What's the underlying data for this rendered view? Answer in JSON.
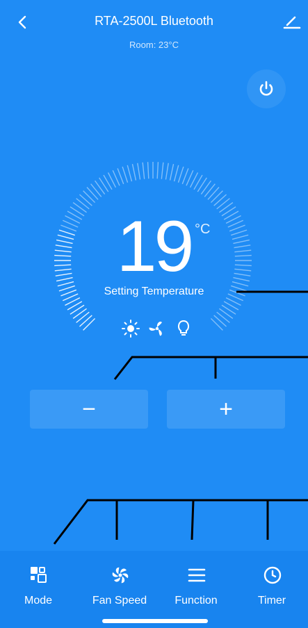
{
  "header": {
    "title": "RTA-2500L Bluetooth",
    "subtitle": "Room: 23°C",
    "icons": [
      "back-chevron-icon",
      "edit-pencil-icon"
    ]
  },
  "power": {
    "icon": "power-icon"
  },
  "thermostat": {
    "temperature": "19",
    "unit": "°C",
    "label": "Setting Temperature",
    "status_icons": [
      "sun-icon",
      "fan-icon",
      "lightbulb-icon"
    ]
  },
  "controls": {
    "minus_label": "−",
    "plus_label": "+"
  },
  "tabs": [
    {
      "label": "Mode",
      "icon": "mode-icon"
    },
    {
      "label": "Fan Speed",
      "icon": "fan-speed-icon"
    },
    {
      "label": "Function",
      "icon": "menu-icon"
    },
    {
      "label": "Timer",
      "icon": "clock-icon"
    }
  ],
  "colors": {
    "background": "#1f8cf5",
    "tabbar": "#1884ef",
    "foreground": "#ffffff"
  }
}
